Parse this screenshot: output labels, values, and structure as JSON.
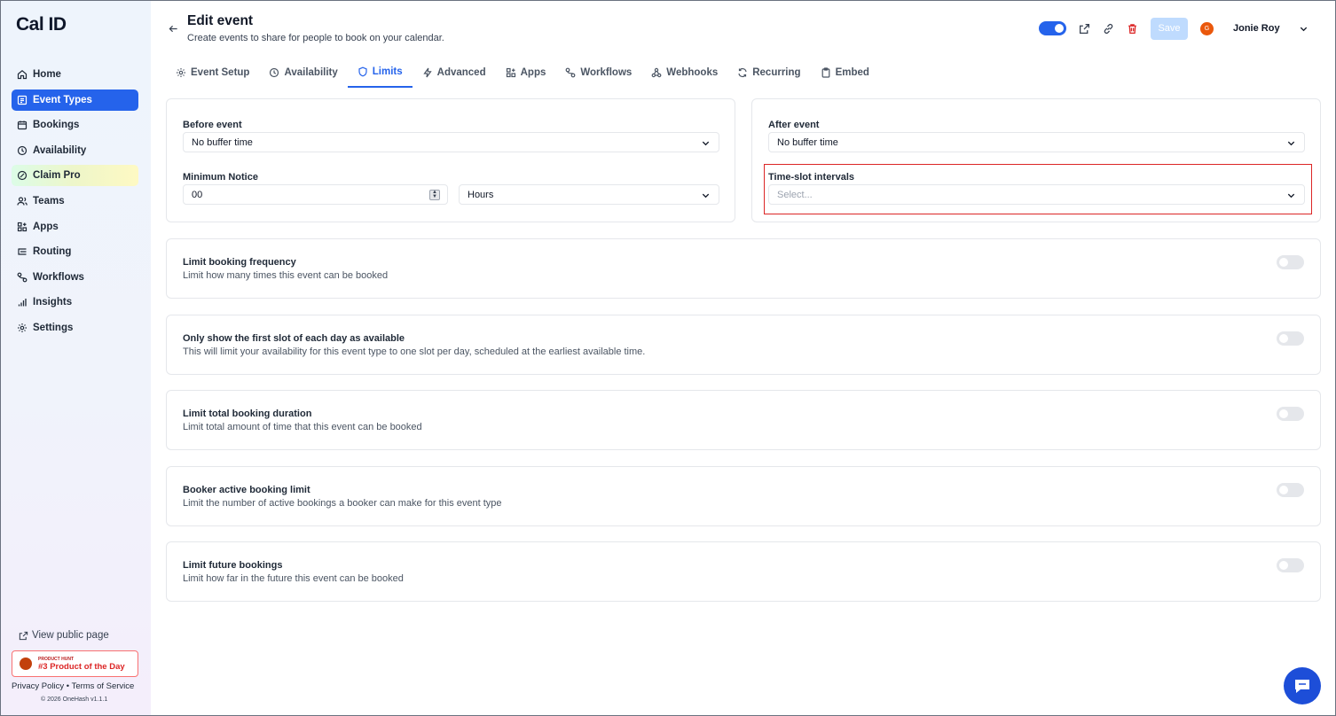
{
  "sidebar": {
    "logo": "Cal ID",
    "items": [
      {
        "label": "Home",
        "icon": "home-icon"
      },
      {
        "label": "Event Types",
        "icon": "event-types-icon"
      },
      {
        "label": "Bookings",
        "icon": "calendar-icon"
      },
      {
        "label": "Availability",
        "icon": "clock-icon"
      },
      {
        "label": "Claim Pro",
        "icon": "badge-icon"
      },
      {
        "label": "Teams",
        "icon": "users-icon"
      },
      {
        "label": "Apps",
        "icon": "apps-icon"
      },
      {
        "label": "Routing",
        "icon": "routing-icon"
      },
      {
        "label": "Workflows",
        "icon": "workflows-icon"
      },
      {
        "label": "Insights",
        "icon": "chart-icon"
      },
      {
        "label": "Settings",
        "icon": "gear-icon"
      }
    ],
    "active_item": "Event Types",
    "view_public_page": "View public page",
    "product_hunt_small": "PRODUCT HUNT",
    "product_hunt_big": "#3 Product of the Day",
    "privacy": "Privacy Policy",
    "separator": "•",
    "terms": "Terms of Service",
    "copyright": "© 2026 OneHash v1.1.1"
  },
  "header": {
    "title": "Edit event",
    "subtitle": "Create events to share for people to book on your calendar.",
    "save_label": "Save",
    "avatar_letter": "G",
    "username": "Jonie Roy",
    "colors": {
      "accent": "#2563eb",
      "danger": "#dc2626",
      "avatar": "#ea580c"
    }
  },
  "tabs": [
    {
      "label": "Event Setup",
      "icon": "gear-icon"
    },
    {
      "label": "Availability",
      "icon": "clock-icon"
    },
    {
      "label": "Limits",
      "icon": "shield-icon"
    },
    {
      "label": "Advanced",
      "icon": "bolt-icon"
    },
    {
      "label": "Apps",
      "icon": "apps-icon"
    },
    {
      "label": "Workflows",
      "icon": "workflows-icon"
    },
    {
      "label": "Webhooks",
      "icon": "webhook-icon"
    },
    {
      "label": "Recurring",
      "icon": "repeat-icon"
    },
    {
      "label": "Embed",
      "icon": "clipboard-icon"
    }
  ],
  "active_tab": "Limits",
  "buffers": {
    "before_label": "Before event",
    "before_value": "No buffer time",
    "after_label": "After event",
    "after_value": "No buffer time",
    "min_notice_label": "Minimum Notice",
    "min_notice_value": "00",
    "min_notice_unit": "Hours",
    "interval_label": "Time-slot intervals",
    "interval_placeholder": "Select..."
  },
  "limits": [
    {
      "title": "Limit booking frequency",
      "description": "Limit how many times this event can be booked",
      "enabled": false
    },
    {
      "title": "Only show the first slot of each day as available",
      "description": "This will limit your availability for this event type to one slot per day, scheduled at the earliest available time.",
      "enabled": false
    },
    {
      "title": "Limit total booking duration",
      "description": "Limit total amount of time that this event can be booked",
      "enabled": false
    },
    {
      "title": "Booker active booking limit",
      "description": "Limit the number of active bookings a booker can make for this event type",
      "enabled": false
    },
    {
      "title": "Limit future bookings",
      "description": "Limit how far in the future this event can be booked",
      "enabled": false
    }
  ]
}
